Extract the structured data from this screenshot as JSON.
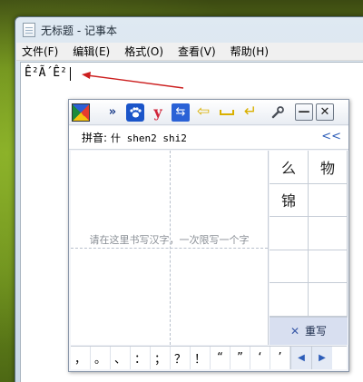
{
  "notepad": {
    "title": "无标题 - 记事本",
    "menu": [
      "文件(F)",
      "编辑(E)",
      "格式(O)",
      "查看(V)",
      "帮助(H)"
    ],
    "content": "Ê²Ã´Ê²"
  },
  "ime": {
    "toolbar_icons": [
      "sogou-logo-icon",
      "expand-icon",
      "paw-icon",
      "y-icon",
      "swap-icon",
      "backspace-arrow-icon",
      "space-icon",
      "enter-icon",
      "wrench-icon",
      "minimize-icon",
      "close-icon"
    ],
    "toolbar_glyphs": {
      "expand": "»",
      "paw": "🐾",
      "y": "y",
      "swap": "⇆",
      "backspace": "⇦",
      "enter": "↵",
      "wrench": "🔧",
      "minimize": "—",
      "close": "✕"
    },
    "pinyin_label": "拼音:",
    "pinyin_value": "什 shen2 shi2",
    "collapse_glyph": "<<",
    "write_hint": "请在这里书写汉字，一次限写一个字",
    "candidates": [
      "么",
      "物",
      "锦",
      "",
      "",
      "",
      "",
      "",
      "",
      ""
    ],
    "rewrite_icon": "✕",
    "rewrite_label": "重写",
    "punctuation": [
      "，",
      "。",
      "、",
      "：",
      "；",
      "？",
      "！",
      "“",
      "”",
      "‘",
      "’"
    ],
    "page_prev": "◀",
    "page_next": "▶"
  },
  "colors": {
    "desktop": "#7ea321",
    "annotation_arrow": "#cc1f1f",
    "rewrite_bg": "#d8dff0"
  }
}
